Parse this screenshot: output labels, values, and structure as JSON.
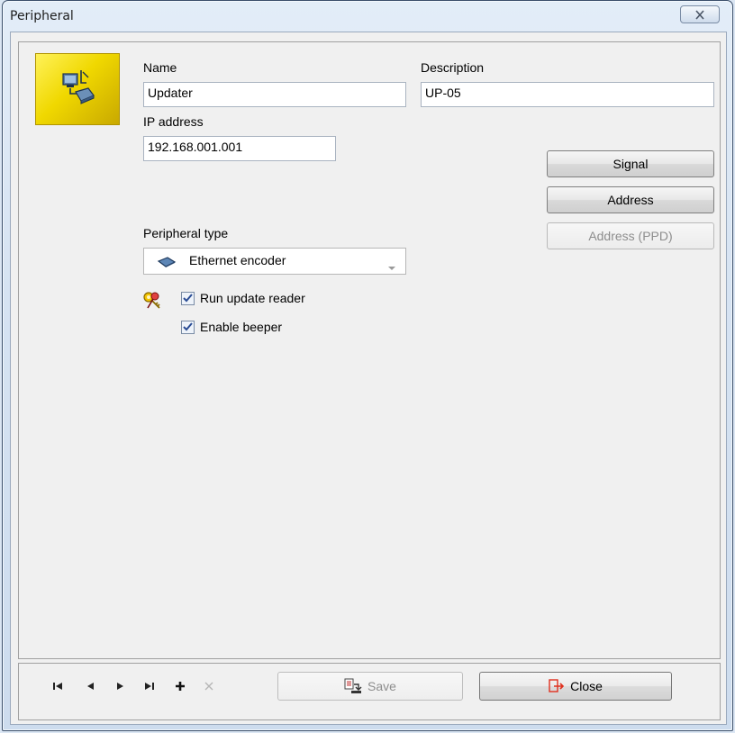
{
  "window": {
    "title": "Peripheral"
  },
  "form": {
    "name_label": "Name",
    "name_value": "Updater",
    "description_label": "Description",
    "description_value": "UP-05",
    "ip_label": "IP address",
    "ip_value": "192.168.001.001",
    "peripheral_type_label": "Peripheral type",
    "peripheral_type_value": "Ethernet encoder",
    "run_update_reader_label": "Run update reader",
    "run_update_reader_checked": true,
    "enable_beeper_label": "Enable beeper",
    "enable_beeper_checked": true
  },
  "side_buttons": {
    "signal": "Signal",
    "address": "Address",
    "address_ppd": "Address (PPD)"
  },
  "footer": {
    "save_label": "Save",
    "close_label": "Close"
  },
  "colors": {
    "icon_tile": "#f0d800",
    "close_icon": "#e0301e",
    "disabled_text": "#8d8d8d"
  }
}
